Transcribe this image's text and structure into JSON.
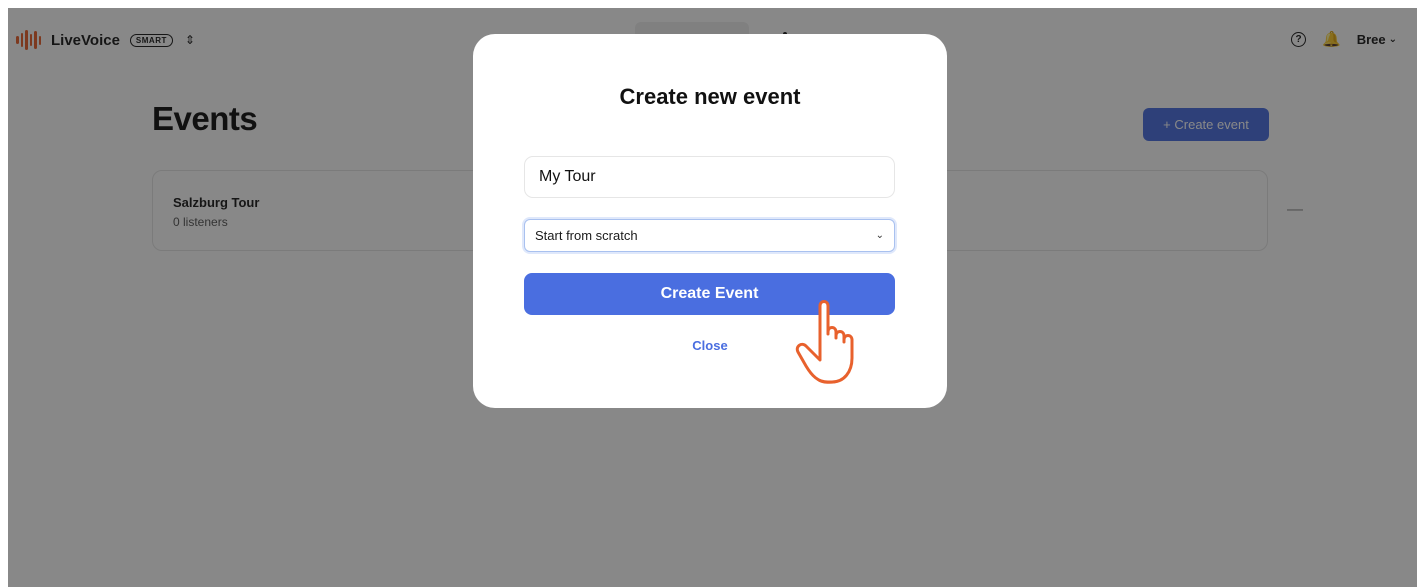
{
  "app": {
    "brand_name": "LiveVoice",
    "plan_badge": "SMART",
    "brand_color": "#e5532c",
    "user_name": "Bree",
    "icons": [
      "logo-icon",
      "switch-icon",
      "help-icon",
      "bell-icon",
      "chevron-down-icon"
    ]
  },
  "page": {
    "title": "Events",
    "create_button_label": "+ Create event",
    "events": [
      {
        "name": "Salzburg Tour",
        "listeners": "0 listeners"
      }
    ]
  },
  "modal": {
    "title": "Create new event",
    "name_value": "My Tour",
    "template_selected": "Start from scratch",
    "submit_label": "Create Event",
    "close_label": "Close"
  },
  "colors": {
    "accent": "#4a6ee0",
    "overlay": "rgba(18,18,18,0.5)",
    "pointer": "#e8612d"
  }
}
